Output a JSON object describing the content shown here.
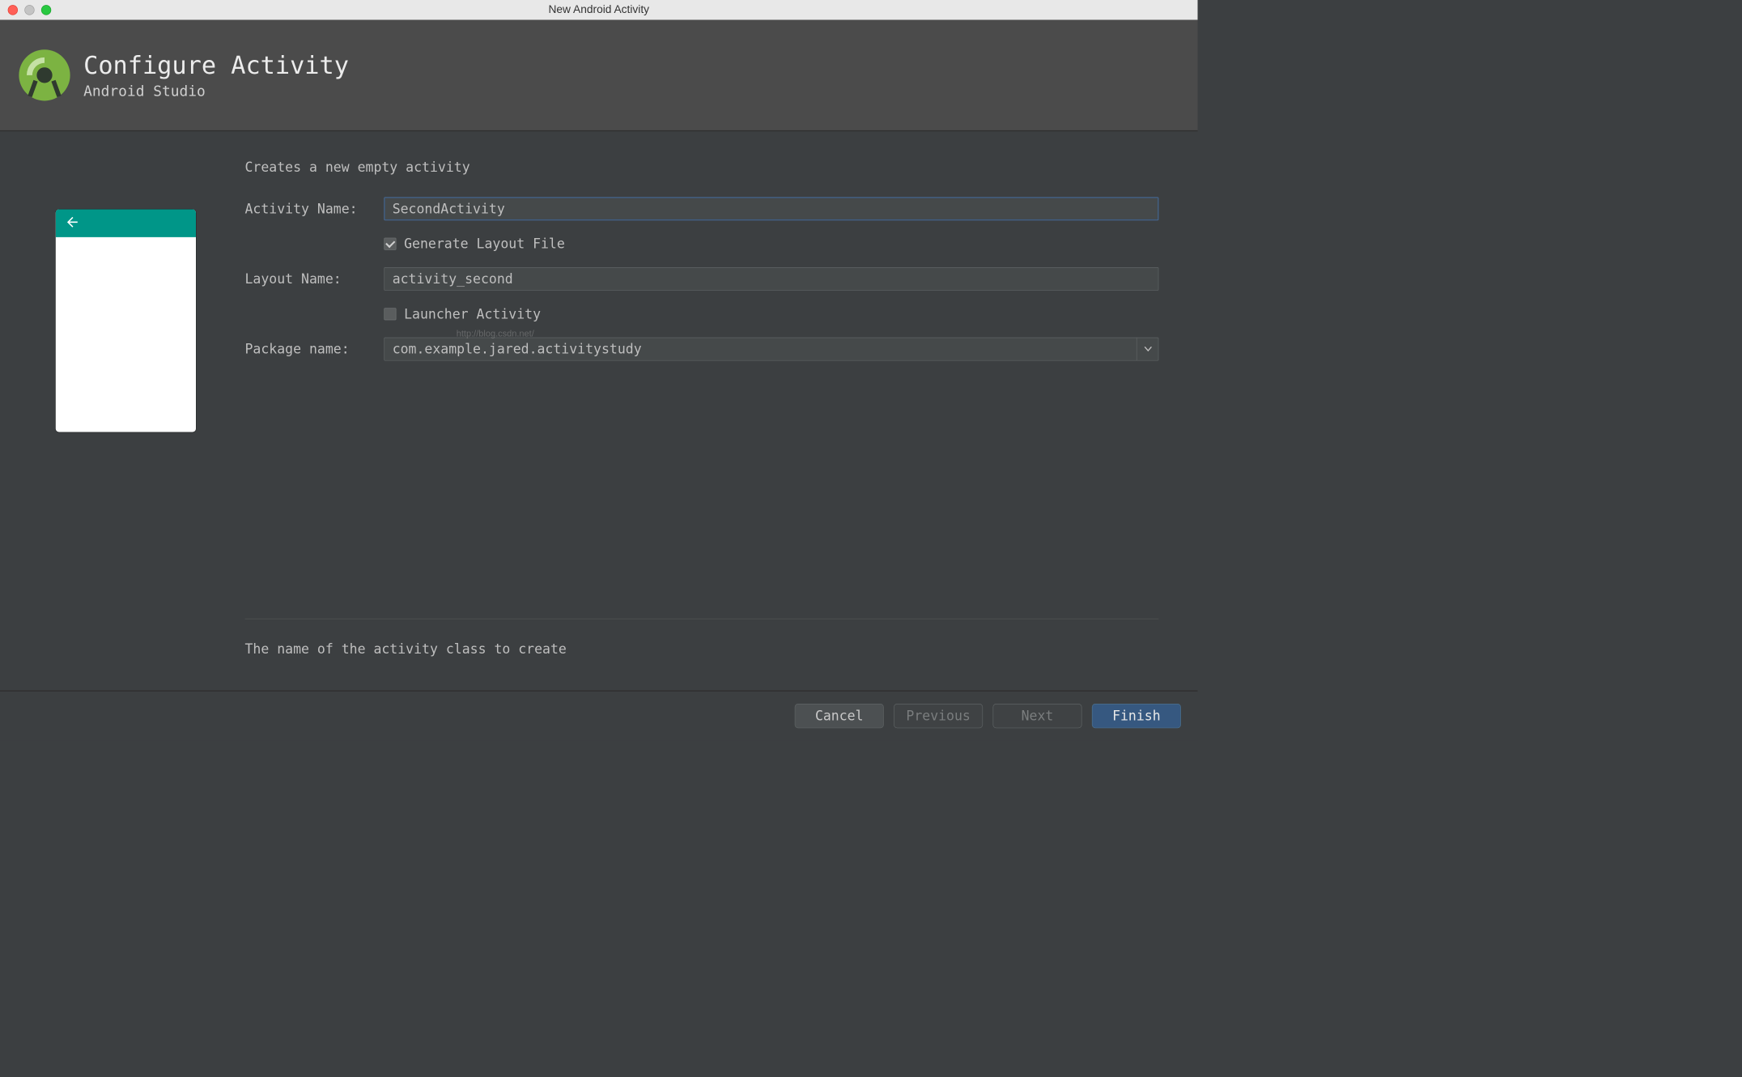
{
  "window": {
    "title": "New Android Activity"
  },
  "header": {
    "title": "Configure Activity",
    "subtitle": "Android Studio"
  },
  "form": {
    "description": "Creates a new empty activity",
    "activity_name_label": "Activity Name:",
    "activity_name_value": "SecondActivity",
    "generate_layout_label": "Generate Layout File",
    "generate_layout_checked": true,
    "layout_name_label": "Layout Name:",
    "layout_name_value": "activity_second",
    "launcher_activity_label": "Launcher Activity",
    "launcher_activity_checked": false,
    "package_name_label": "Package name:",
    "package_name_value": "com.example.jared.activitystudy",
    "help_text": "The name of the activity class to create",
    "watermark": "http://blog.csdn.net/"
  },
  "footer": {
    "cancel": "Cancel",
    "previous": "Previous",
    "next": "Next",
    "finish": "Finish"
  }
}
